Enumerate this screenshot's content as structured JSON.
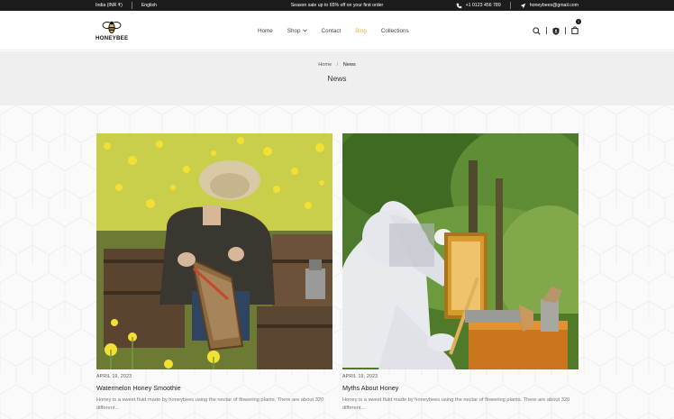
{
  "topbar": {
    "country": "India (INR ₹)",
    "language": "English",
    "promo": "Season sale up to 65% off on your first order",
    "phone": "+1 0123 456 789",
    "email": "honeybees@gmail.com"
  },
  "header": {
    "logo_text": "HONEYBEE",
    "nav": [
      {
        "label": "Home"
      },
      {
        "label": "Shop"
      },
      {
        "label": "Contact"
      },
      {
        "label": "Blog"
      },
      {
        "label": "Collections"
      }
    ],
    "cart_count": "1",
    "accent": "#e9b24a"
  },
  "page": {
    "breadcrumb_home": "Home",
    "breadcrumb_sep": "/",
    "breadcrumb_current": "News",
    "title": "News"
  },
  "posts": [
    {
      "date": "APRIL 19, 2023",
      "title": "Watermelon Honey Smoothie",
      "excerpt": "Honey is a sweet fluid made by honeybees using the nectar of flowering plants. There are about 320 different..."
    },
    {
      "date": "APRIL 19, 2023",
      "title": "Myths About Honey",
      "excerpt": "Honey is a sweet fluid made by honeybees using the nectar of flowering plants. There are about 320 different..."
    }
  ]
}
